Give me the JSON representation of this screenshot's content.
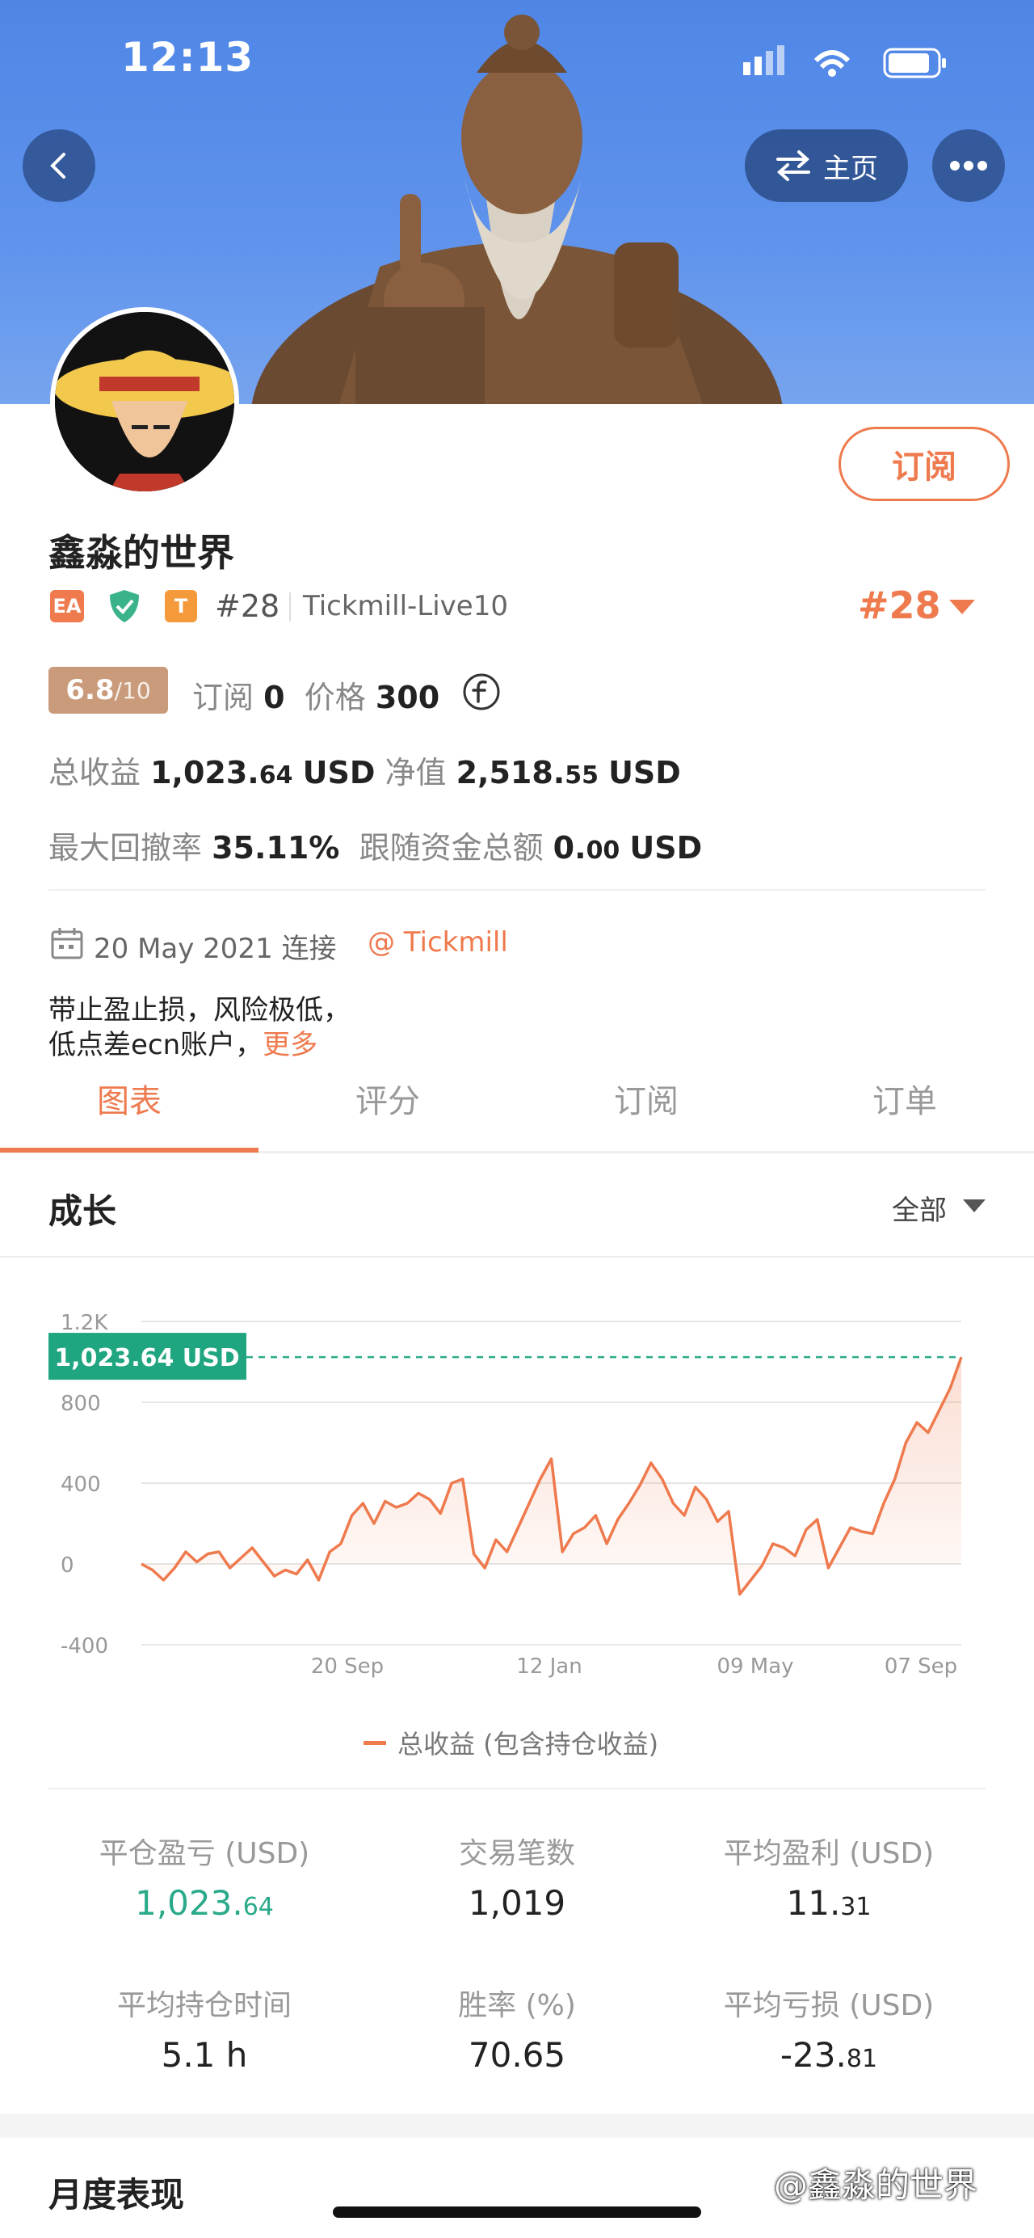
{
  "status_bar": {
    "time": "12:13"
  },
  "header": {
    "home_label": "主页"
  },
  "profile": {
    "name": "鑫淼的世界",
    "badges": {
      "ea": "EA",
      "t": "T"
    },
    "rank": "#28",
    "account": "Tickmill-Live10",
    "rank_big": "#28",
    "subscribe_label": "订阅",
    "score": "6.8",
    "score_max": "/10",
    "subscriptions_label": "订阅",
    "subscriptions_value": "0",
    "price_label": "价格",
    "price_value": "300",
    "total_profit_label": "总收益",
    "total_profit_int": "1,023.",
    "total_profit_dec": "64",
    "total_profit_unit": "USD",
    "equity_label": "净值",
    "equity_int": "2,518.",
    "equity_dec": "55",
    "equity_unit": "USD",
    "max_drawdown_label": "最大回撤率",
    "max_drawdown_value": "35.11%",
    "follow_funds_label": "跟随资金总额",
    "follow_funds_int": "0.",
    "follow_funds_dec": "00",
    "follow_funds_unit": "USD",
    "connect_date": "20 May 2021 连接",
    "broker": "@ Tickmill",
    "desc_line1": "带止盈止损，风险极低，",
    "desc_line2": "低点差ecn账户，",
    "more_label": "更多"
  },
  "tabs": [
    {
      "label": "图表"
    },
    {
      "label": "评分"
    },
    {
      "label": "订阅"
    },
    {
      "label": "订单"
    }
  ],
  "growth": {
    "title": "成长",
    "filter": "全部"
  },
  "chart_data": {
    "type": "area",
    "y_ticks": [
      "1.2K",
      "800",
      "400",
      "0",
      "-400"
    ],
    "ylim": [
      -400,
      1200
    ],
    "x_ticks": [
      "20 Sep",
      "12 Jan",
      "09 May",
      "07 Sep"
    ],
    "current_label": "1,023.64 USD",
    "current_value": 1023.64,
    "legend": "总收益 (包含持仓收益)",
    "series": [
      {
        "values": [
          0,
          -30,
          -80,
          -20,
          60,
          10,
          50,
          60,
          -20,
          30,
          80,
          10,
          -60,
          -30,
          -50,
          20,
          -80,
          60,
          100,
          240,
          300,
          200,
          310,
          280,
          300,
          350,
          320,
          250,
          400,
          420,
          50,
          -20,
          120,
          60,
          180,
          300,
          420,
          520,
          60,
          150,
          180,
          240,
          100,
          220,
          300,
          390,
          500,
          420,
          300,
          240,
          380,
          320,
          210,
          260,
          -150,
          -80,
          -10,
          100,
          80,
          40,
          170,
          220,
          -20,
          80,
          180,
          160,
          150,
          300,
          420,
          600,
          700,
          650,
          760,
          870,
          1023.64
        ]
      }
    ]
  },
  "stats": [
    {
      "label": "平仓盈亏 (USD)",
      "int": "1,023.",
      "dec": "64",
      "color": "#2aaa8a"
    },
    {
      "label": "交易笔数",
      "int": "1,019",
      "dec": ""
    },
    {
      "label": "平均盈利 (USD)",
      "int": "11.",
      "dec": "31"
    },
    {
      "label": "平均持仓时间",
      "int": "5.1 h",
      "dec": ""
    },
    {
      "label": "胜率 (%)",
      "int": "70.65",
      "dec": ""
    },
    {
      "label": "平均亏损 (USD)",
      "int": "-23.",
      "dec": "81"
    }
  ],
  "monthly": {
    "title": "月度表现"
  },
  "watermark": "@鑫淼的世界"
}
